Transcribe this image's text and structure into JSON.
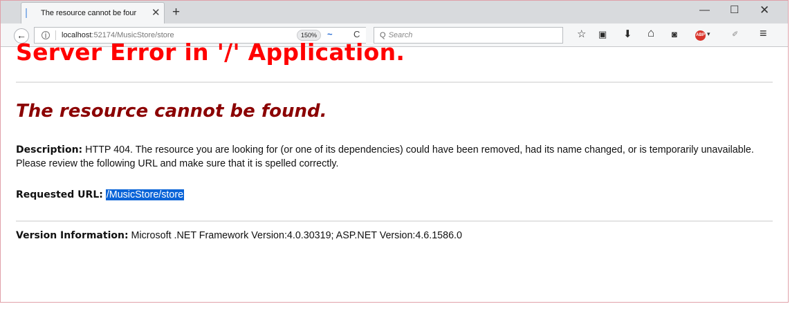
{
  "tab": {
    "title": "The resource cannot be four",
    "close": "✕"
  },
  "new_tab_label": "+",
  "window_controls": {
    "minimize": "—",
    "maximize": "☐",
    "close": "✕"
  },
  "nav": {
    "back": "←",
    "url_host": "localhost",
    "url_rest": ":52174/MusicStore/store",
    "zoom": "150%",
    "search_placeholder": "Search"
  },
  "icons": {
    "info": "i",
    "reload": "C",
    "bookmark": "☆",
    "clipboard": "▣",
    "download": "⬇",
    "home": "⌂",
    "pocket": "◙",
    "adblock": "ABP",
    "adblock_caret": "▾",
    "extension": "✐",
    "menu": "≡",
    "reader": "~",
    "search": "Q"
  },
  "page": {
    "heading": "Server Error in '/' Application.",
    "subheading": "The resource cannot be found.",
    "description_label": "Description:",
    "description_text": "HTTP 404. The resource you are looking for (or one of its dependencies) could have been removed, had its name changed, or is temporarily unavailable.  Please review the following URL and make sure that it is spelled correctly.",
    "requested_url_label": "Requested URL:",
    "requested_url": "/MusicStore/store",
    "version_label": "Version Information:",
    "version_text": "Microsoft .NET Framework Version:4.0.30319; ASP.NET Version:4.6.1586.0"
  }
}
